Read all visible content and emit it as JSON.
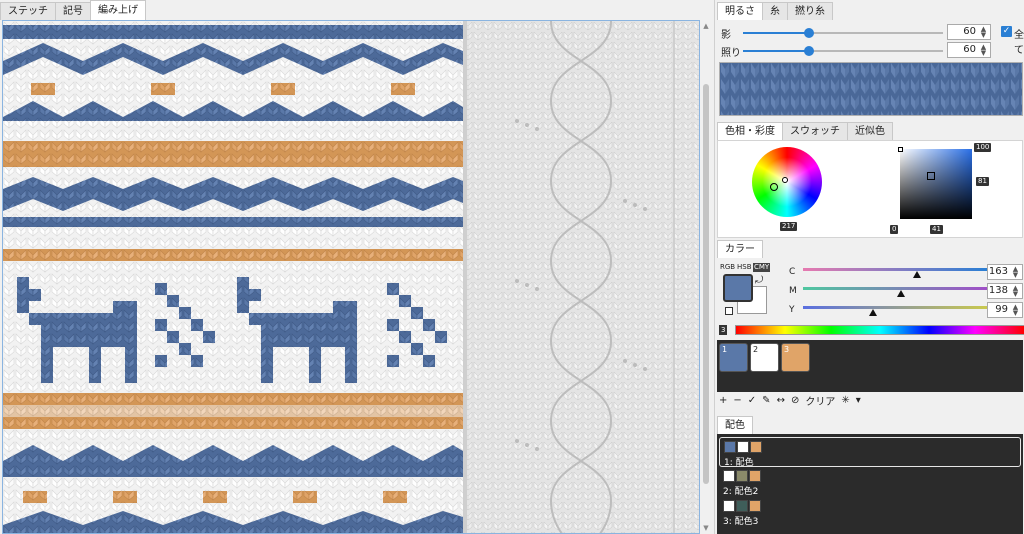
{
  "left_tabs": [
    "ステッチ",
    "記号",
    "編み上げ"
  ],
  "right_top_tabs": [
    "明るさ",
    "糸",
    "撚り糸"
  ],
  "shadow": {
    "label": "影",
    "value": "60",
    "level": 0.33
  },
  "light": {
    "label": "照り",
    "value": "60",
    "level": 0.33
  },
  "all_label": "全て",
  "color_tabs": [
    "色相・彩度",
    "スウォッチ",
    "近似色"
  ],
  "wheel": {
    "hue_value": "217"
  },
  "sv": {
    "top_right": "100",
    "right": "81",
    "bottom_left": "0",
    "bottom": "41"
  },
  "color_tab_label": "カラー",
  "color_modes": [
    "RGB",
    "HSB",
    "CMY"
  ],
  "cmy": [
    {
      "label": "C",
      "value": "163",
      "level": 0.62
    },
    {
      "label": "M",
      "value": "138",
      "level": 0.53
    },
    {
      "label": "Y",
      "value": "99",
      "level": 0.38
    }
  ],
  "count_label": "3",
  "swatches": [
    {
      "num": "1",
      "color": "#5a78a8"
    },
    {
      "num": "2",
      "color": "#ffffff"
    },
    {
      "num": "3",
      "color": "#e0a468"
    }
  ],
  "swatch_tools": {
    "add": "+",
    "remove": "−",
    "apply": "✓",
    "edit": "✎",
    "swap": "↔",
    "block": "⊘",
    "clear_label": "クリア",
    "star": "✳",
    "menu": "▾"
  },
  "palette_header": "配色",
  "palettes": [
    {
      "name": "1: 配色",
      "colors": [
        "#5a78a8",
        "#ffffff",
        "#e0a468"
      ]
    },
    {
      "name": "2: 配色2",
      "colors": [
        "#ffffff",
        "#8a8a6a",
        "#e0a468"
      ]
    },
    {
      "name": "3: 配色3",
      "colors": [
        "#ffffff",
        "#3f5e5a",
        "#e0a468"
      ]
    }
  ],
  "colors": {
    "blue": "#5a78a8",
    "tan": "#e0a468",
    "white": "#ffffff",
    "accent": "#2a7fd4"
  }
}
